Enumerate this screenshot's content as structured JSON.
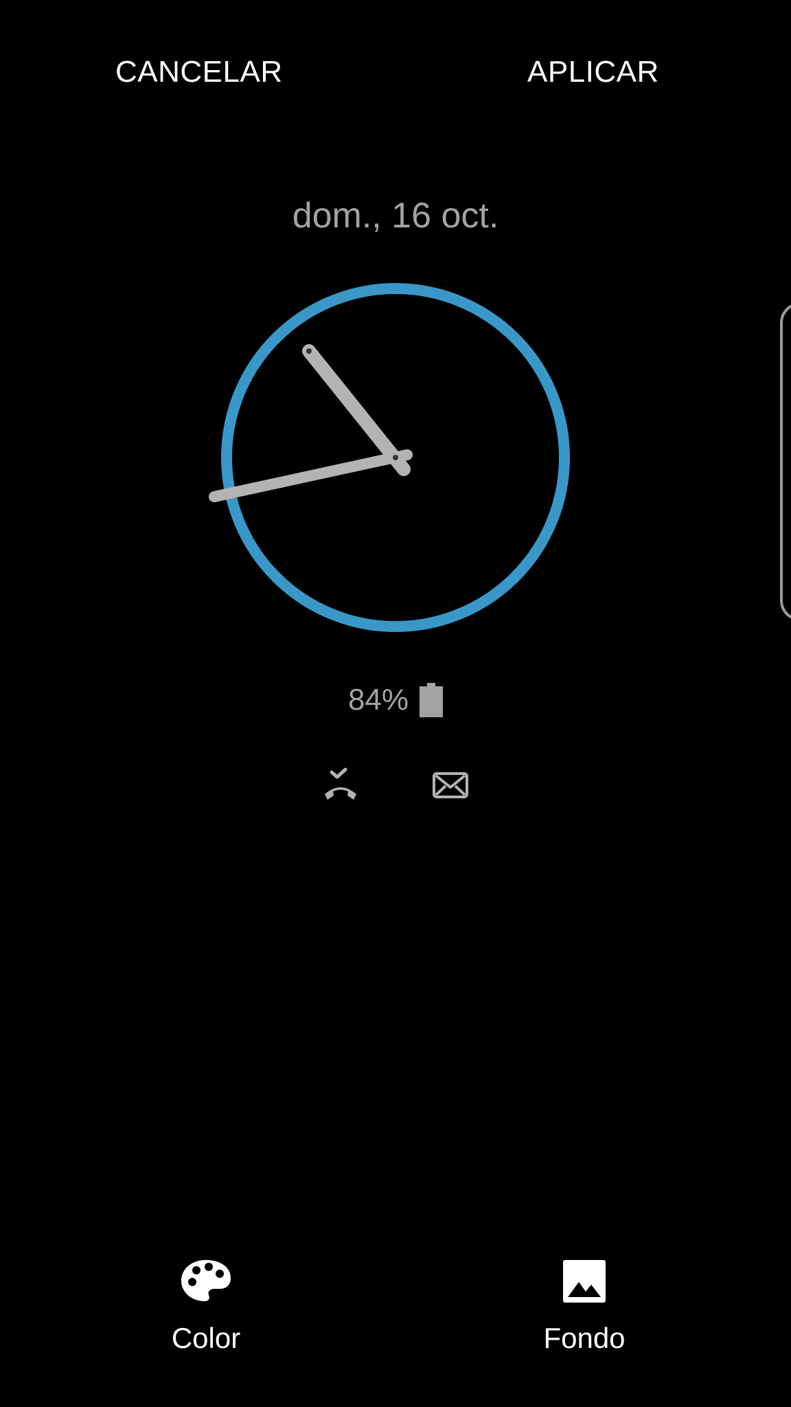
{
  "header": {
    "cancel_label": "CANCELAR",
    "apply_label": "APLICAR"
  },
  "lockscreen": {
    "date": "dom., 16 oct.",
    "clock": {
      "type": "analog",
      "ring_color": "#3a97c8",
      "hand_color": "#b3b3b3"
    },
    "battery": {
      "percent_text": "84%",
      "icon": "battery-icon"
    },
    "notifications": [
      {
        "icon": "missed-call-icon"
      },
      {
        "icon": "mail-icon"
      }
    ]
  },
  "edge_panel": {
    "icon": "edge-panel-handle"
  },
  "bottom_bar": {
    "color_label": "Color",
    "color_icon": "palette-icon",
    "wallpaper_label": "Fondo",
    "wallpaper_icon": "image-icon"
  }
}
